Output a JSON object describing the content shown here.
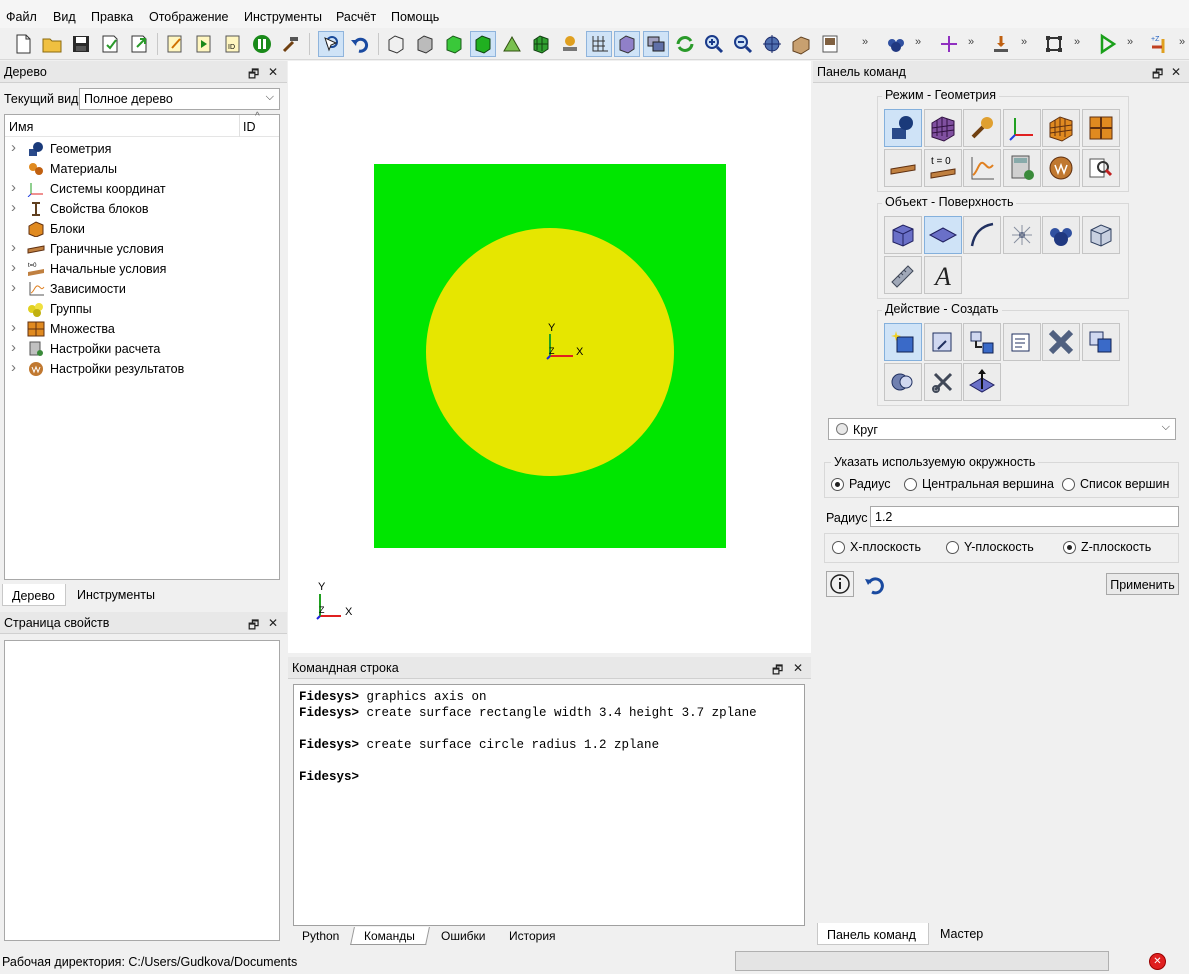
{
  "menu": [
    "Файл",
    "Вид",
    "Правка",
    "Отображение",
    "Инструменты",
    "Расчёт",
    "Помощь"
  ],
  "tree_panel": {
    "title": "Дерево",
    "view_label": "Текущий вид",
    "view_value": "Полное дерево",
    "col_name": "Имя",
    "col_id": "ID",
    "items": [
      {
        "label": "Геометрия",
        "icon": "geometry-icon",
        "expandable": true
      },
      {
        "label": "Материалы",
        "icon": "materials-icon",
        "expandable": false
      },
      {
        "label": "Системы координат",
        "icon": "coord-systems-icon",
        "expandable": true
      },
      {
        "label": "Свойства блоков",
        "icon": "block-properties-icon",
        "expandable": true
      },
      {
        "label": "Блоки",
        "icon": "blocks-icon",
        "expandable": false
      },
      {
        "label": "Граничные условия",
        "icon": "boundary-conditions-icon",
        "expandable": true
      },
      {
        "label": "Начальные условия",
        "icon": "initial-conditions-icon",
        "expandable": true
      },
      {
        "label": "Зависимости",
        "icon": "dependencies-icon",
        "expandable": true
      },
      {
        "label": "Группы",
        "icon": "groups-icon",
        "expandable": false
      },
      {
        "label": "Множества",
        "icon": "sets-icon",
        "expandable": true
      },
      {
        "label": "Настройки расчета",
        "icon": "calc-settings-icon",
        "expandable": true
      },
      {
        "label": "Настройки результатов",
        "icon": "results-settings-icon",
        "expandable": true
      }
    ],
    "tabs": [
      "Дерево",
      "Инструменты"
    ]
  },
  "properties_panel": {
    "title": "Страница свойств"
  },
  "viewport": {
    "axis_x": "X",
    "axis_y": "Y",
    "axis_z": "Z",
    "rect_color": "#00e600",
    "circle_color": "#e6e600"
  },
  "command_line": {
    "title": "Командная строка",
    "prompt": "Fidesys>",
    "lines": [
      {
        "prompt": "Fidesys>",
        "cmd": " graphics axis on"
      },
      {
        "prompt": "Fidesys>",
        "cmd": " create surface rectangle width 3.4 height 3.7 zplane"
      },
      {
        "prompt": "",
        "cmd": ""
      },
      {
        "prompt": "Fidesys>",
        "cmd": " create surface circle radius 1.2 zplane"
      },
      {
        "prompt": "",
        "cmd": ""
      },
      {
        "prompt": "Fidesys>",
        "cmd": ""
      }
    ],
    "tabs": [
      "Python",
      "Команды",
      "Ошибки",
      "История"
    ]
  },
  "command_panel": {
    "title": "Панель команд",
    "mode_group": "Режим - Геометрия",
    "object_group": "Объект - Поверхность",
    "action_group": "Действие - Создать",
    "shape_value": "Круг",
    "circle_group": "Указать используемую окружность",
    "circle_options": [
      "Радиус",
      "Центральная вершина",
      "Список вершин"
    ],
    "circle_selected": 0,
    "radius_label": "Радиус",
    "radius_value": "1.2",
    "plane_options": [
      "X-плоскость",
      "Y-плоскость",
      "Z-плоскость"
    ],
    "plane_selected": 2,
    "apply_label": "Применить",
    "t0_label": "t = 0",
    "tabs": [
      "Панель команд",
      "Мастер"
    ]
  },
  "status": {
    "workdir": "Рабочая директория: C:/Users/Gudkova/Documents"
  }
}
